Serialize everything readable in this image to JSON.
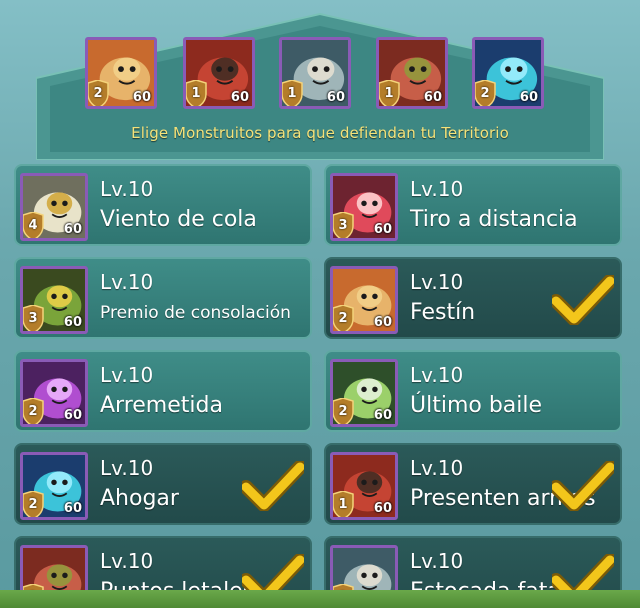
{
  "banner": {
    "prompt": "Elige Monstruitos para que defiendan tu Territorio",
    "defenders": [
      {
        "stars": "2",
        "level": "60",
        "icon": "bloated-frog-monster-icon"
      },
      {
        "stars": "1",
        "level": "60",
        "icon": "red-boar-warrior-icon"
      },
      {
        "stars": "1",
        "level": "60",
        "icon": "grey-troll-icon"
      },
      {
        "stars": "1",
        "level": "60",
        "icon": "red-boar-chef-icon"
      },
      {
        "stars": "2",
        "level": "60",
        "icon": "blue-water-spirit-icon"
      }
    ]
  },
  "cards": [
    {
      "lv": "Lv.10",
      "name": "Viento de cola",
      "stars": "4",
      "level": "60",
      "selected": false,
      "icon": "griffin-icon"
    },
    {
      "lv": "Lv.10",
      "name": "Tiro a distancia",
      "stars": "3",
      "level": "60",
      "selected": false,
      "icon": "red-slime-icon"
    },
    {
      "lv": "Lv.10",
      "name": "Premio de consolación",
      "stars": "3",
      "level": "60",
      "selected": false,
      "icon": "green-goblin-icon"
    },
    {
      "lv": "Lv.10",
      "name": "Festín",
      "stars": "2",
      "level": "60",
      "selected": true,
      "icon": "bloated-frog-monster-icon"
    },
    {
      "lv": "Lv.10",
      "name": "Arremetida",
      "stars": "2",
      "level": "60",
      "selected": false,
      "icon": "purple-fairy-icon"
    },
    {
      "lv": "Lv.10",
      "name": "Último baile",
      "stars": "2",
      "level": "60",
      "selected": false,
      "icon": "leaf-dryad-icon"
    },
    {
      "lv": "Lv.10",
      "name": "Ahogar",
      "stars": "2",
      "level": "60",
      "selected": true,
      "icon": "blue-water-spirit-icon"
    },
    {
      "lv": "Lv.10",
      "name": "Presenten armas",
      "stars": "1",
      "level": "60",
      "selected": true,
      "icon": "red-boar-warrior-icon"
    },
    {
      "lv": "Lv.10",
      "name": "Puntos letales",
      "stars": "1",
      "level": "60",
      "selected": true,
      "icon": "red-boar-chef-icon"
    },
    {
      "lv": "Lv.10",
      "name": "Estocada fatal",
      "stars": "1",
      "level": "60",
      "selected": true,
      "icon": "grey-troll-icon"
    }
  ],
  "colors": {
    "accent_yellow": "#f3c61b",
    "frame_purple": "#8a5bb6",
    "card_teal": "#3f8d88",
    "card_selected": "#2b5a59"
  }
}
